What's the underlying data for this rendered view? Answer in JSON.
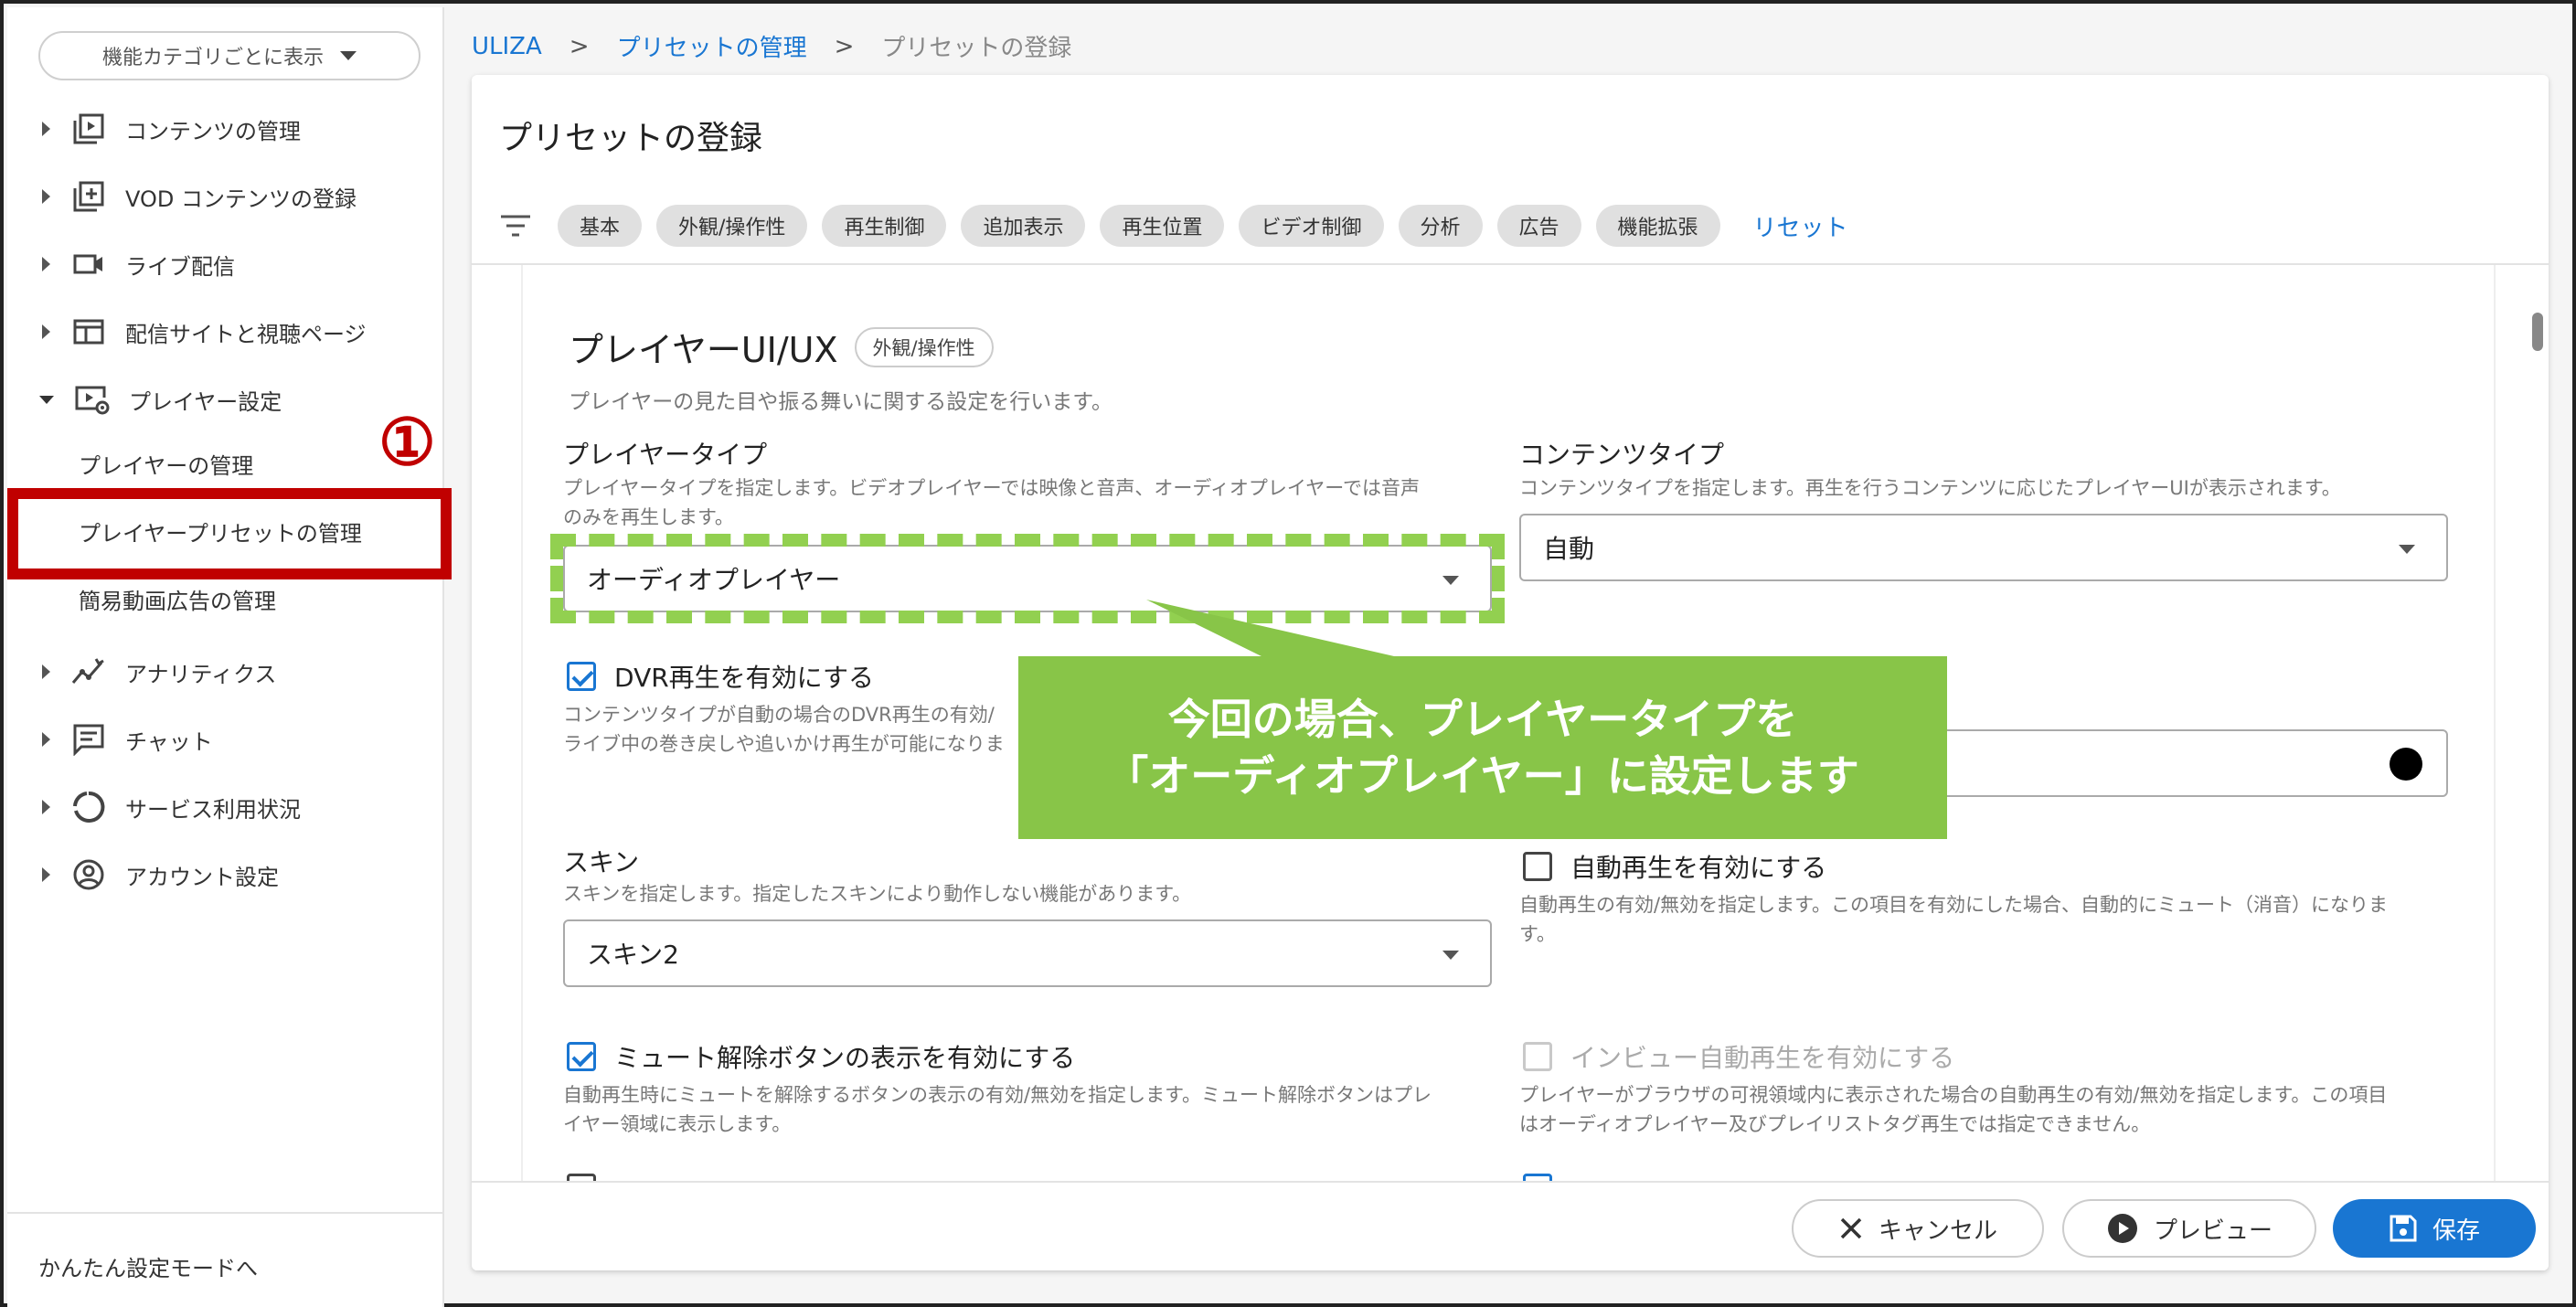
{
  "sidebar": {
    "category_button": "機能カテゴリごとに表示",
    "items": [
      {
        "label": "コンテンツの管理",
        "icon": "content-library-icon"
      },
      {
        "label": "VOD コンテンツの登録",
        "icon": "add-box-icon"
      },
      {
        "label": "ライブ配信",
        "icon": "video-camera-icon"
      },
      {
        "label": "配信サイトと視聴ページ",
        "icon": "web-page-icon"
      },
      {
        "label": "プレイヤー設定",
        "icon": "player-settings-icon"
      },
      {
        "label": "アナリティクス",
        "icon": "analytics-icon"
      },
      {
        "label": "チャット",
        "icon": "chat-icon"
      },
      {
        "label": "サービス利用状況",
        "icon": "usage-ring-icon"
      },
      {
        "label": "アカウント設定",
        "icon": "account-icon"
      }
    ],
    "sub_items": [
      "プレイヤーの管理",
      "プレイヤープリセットの管理",
      "簡易動画広告の管理"
    ],
    "bottom_link": "かんたん設定モードへ"
  },
  "annotation": {
    "step_number": "①",
    "callout_line1": "今回の場合、プレイヤータイプを",
    "callout_line2": "「オーディオプレイヤー」に設定します"
  },
  "breadcrumb": {
    "root": "ULIZA",
    "sep": ">",
    "parent": "プリセットの管理",
    "current": "プリセットの登録"
  },
  "page": {
    "title": "プリセットの登録",
    "filters": [
      "基本",
      "外観/操作性",
      "再生制御",
      "追加表示",
      "再生位置",
      "ビデオ制御",
      "分析",
      "広告",
      "機能拡張"
    ],
    "reset": "リセット"
  },
  "section": {
    "title": "プレイヤーUI/UX",
    "badge": "外観/操作性",
    "desc": "プレイヤーの見た目や振る舞いに関する設定を行います。"
  },
  "fields": {
    "player_type": {
      "label": "プレイヤータイプ",
      "desc1": "プレイヤータイプを指定します。ビデオプレイヤーでは映像と音声、オーディオプレイヤーでは音声",
      "desc2": "のみを再生します。",
      "value": "オーディオプレイヤー"
    },
    "content_type": {
      "label": "コンテンツタイプ",
      "desc": "コンテンツタイプを指定します。再生を行うコンテンツに応じたプレイヤーUIが表示されます。",
      "value": "自動"
    },
    "dvr": {
      "label": "DVR再生を有効にする",
      "desc1": "コンテンツタイプが自動の場合のDVR再生の有効/",
      "desc2": "ライブ中の巻き戻しや追いかけ再生が可能になりま",
      "checked": true
    },
    "skin": {
      "label": "スキン",
      "desc": "スキンを指定します。指定したスキンにより動作しない機能があります。",
      "value": "スキン2"
    },
    "autoplay": {
      "label": "自動再生を有効にする",
      "desc1": "自動再生の有効/無効を指定します。この項目を有効にした場合、自動的にミュート（消音）になりま",
      "desc2": "す。",
      "checked": false
    },
    "unmute": {
      "label": "ミュート解除ボタンの表示を有効にする",
      "desc1": "自動再生時にミュートを解除するボタンの表示の有効/無効を指定します。ミュート解除ボタンはプレ",
      "desc2": "イヤー領域に表示します。",
      "checked": true
    },
    "inview": {
      "label": "インビュー自動再生を有効にする",
      "desc1": "プレイヤーがブラウザの可視領域内に表示された場合の自動再生の有効/無効を指定します。この項目",
      "desc2": "はオーディオプレイヤー及びプレイリストタグ再生では指定できません。",
      "checked": false,
      "disabled": true
    }
  },
  "footer": {
    "cancel": "キャンセル",
    "preview": "プレビュー",
    "save": "保存"
  },
  "colors": {
    "accent": "#1976d2",
    "callout": "#88c548",
    "highlight": "#c00000"
  }
}
